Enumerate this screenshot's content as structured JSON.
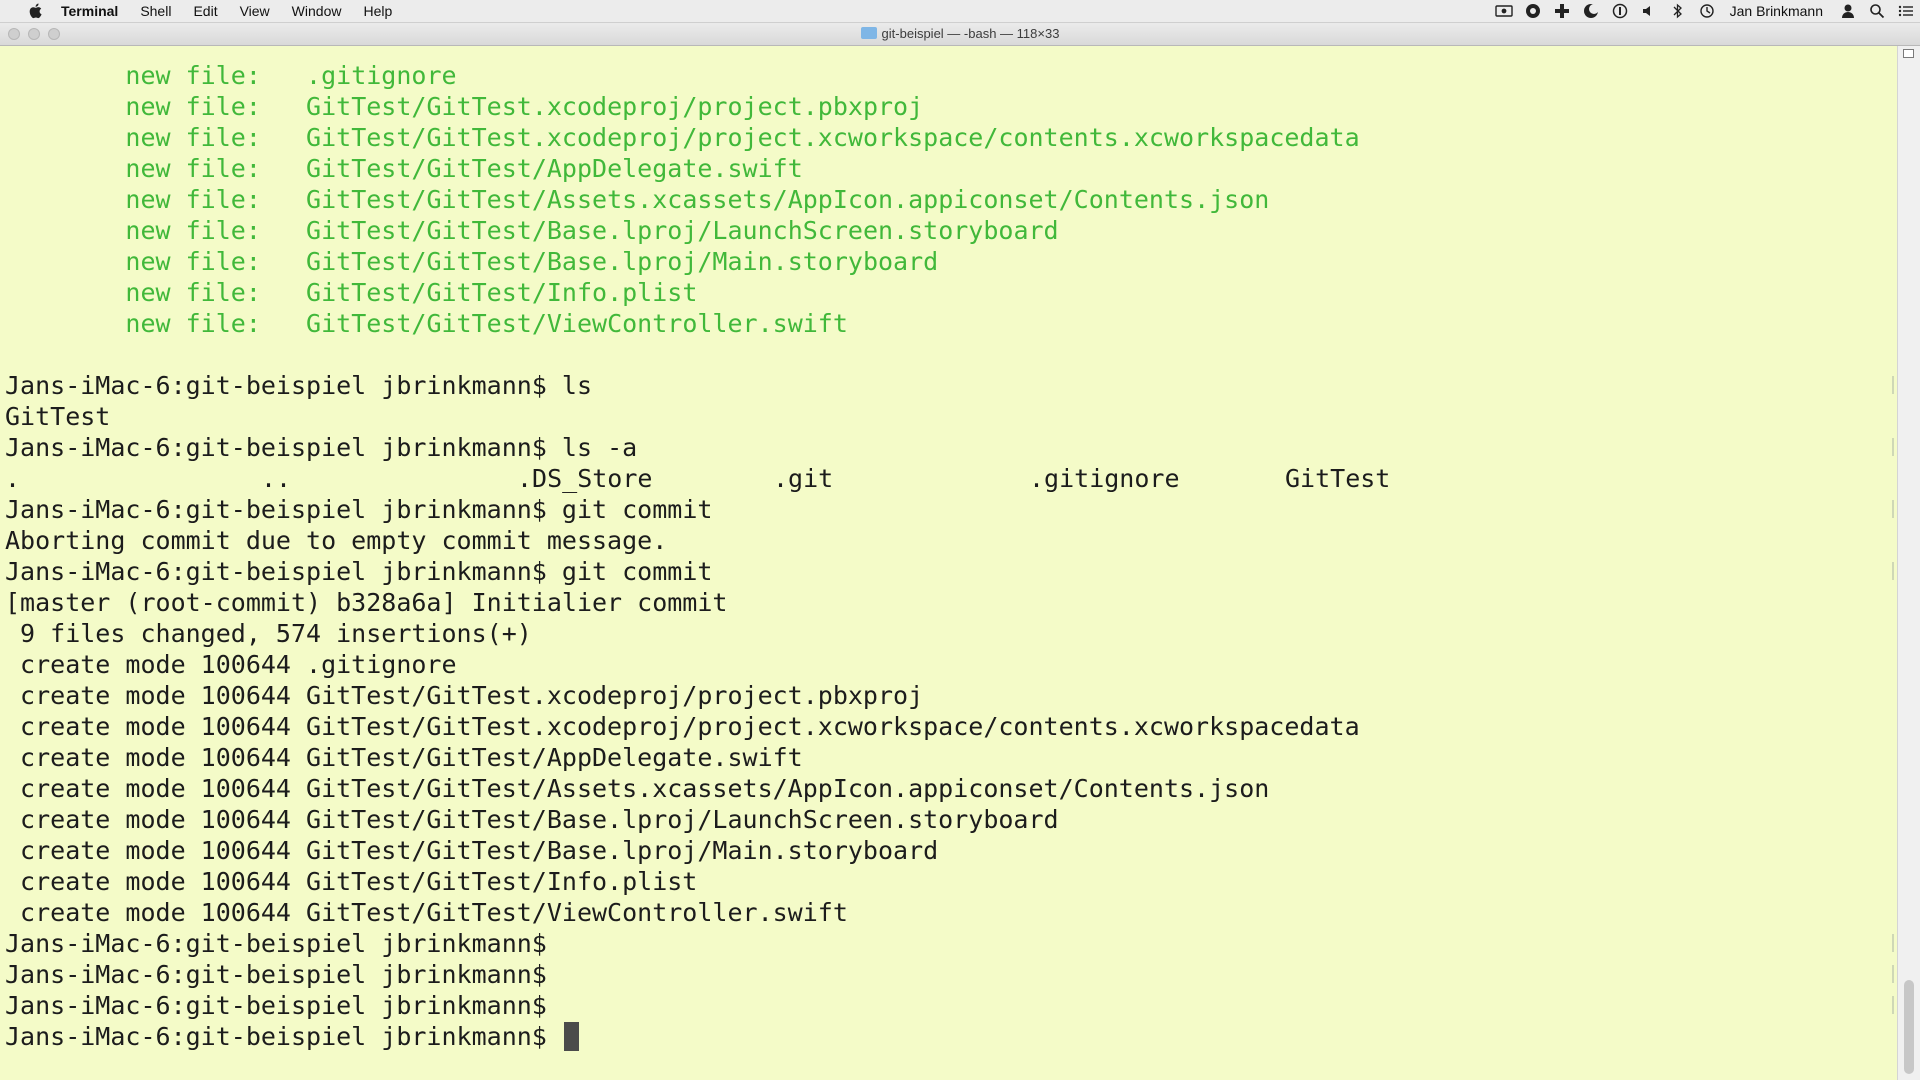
{
  "menubar": {
    "items": [
      "Terminal",
      "Shell",
      "Edit",
      "View",
      "Window",
      "Help"
    ],
    "user": "Jan Brinkmann",
    "status_icons": [
      "screen-record-icon",
      "creative-cloud-icon",
      "add-icon",
      "moon-icon",
      "info-icon",
      "volume-icon",
      "bluetooth-icon",
      "time-machine-icon"
    ]
  },
  "window": {
    "title": "git-beispiel — -bash — 118×33"
  },
  "terminal": {
    "colors": {
      "background": "#f4fbc8",
      "text": "#1c1c1c",
      "green": "#41b83a"
    },
    "staged_files": [
      {
        "label": "new file:",
        "path": ".gitignore"
      },
      {
        "label": "new file:",
        "path": "GitTest/GitTest.xcodeproj/project.pbxproj"
      },
      {
        "label": "new file:",
        "path": "GitTest/GitTest.xcodeproj/project.xcworkspace/contents.xcworkspacedata"
      },
      {
        "label": "new file:",
        "path": "GitTest/GitTest/AppDelegate.swift"
      },
      {
        "label": "new file:",
        "path": "GitTest/GitTest/Assets.xcassets/AppIcon.appiconset/Contents.json"
      },
      {
        "label": "new file:",
        "path": "GitTest/GitTest/Base.lproj/LaunchScreen.storyboard"
      },
      {
        "label": "new file:",
        "path": "GitTest/GitTest/Base.lproj/Main.storyboard"
      },
      {
        "label": "new file:",
        "path": "GitTest/GitTest/Info.plist"
      },
      {
        "label": "new file:",
        "path": "GitTest/GitTest/ViewController.swift"
      }
    ],
    "prompt": "Jans-iMac-6:git-beispiel jbrinkmann$",
    "cmd_ls": "ls",
    "out_ls": "GitTest",
    "cmd_ls_a": "ls -a",
    "out_ls_a": [
      ".",
      "..",
      ".DS_Store",
      ".git",
      ".gitignore",
      "GitTest"
    ],
    "cmd_commit": "git commit",
    "out_abort": "Aborting commit due to empty commit message.",
    "out_commit_header": "[master (root-commit) b328a6a] Initialier commit",
    "out_commit_stats": " 9 files changed, 574 insertions(+)",
    "out_create_modes": [
      " create mode 100644 .gitignore",
      " create mode 100644 GitTest/GitTest.xcodeproj/project.pbxproj",
      " create mode 100644 GitTest/GitTest.xcodeproj/project.xcworkspace/contents.xcworkspacedata",
      " create mode 100644 GitTest/GitTest/AppDelegate.swift",
      " create mode 100644 GitTest/GitTest/Assets.xcassets/AppIcon.appiconset/Contents.json",
      " create mode 100644 GitTest/GitTest/Base.lproj/LaunchScreen.storyboard",
      " create mode 100644 GitTest/GitTest/Base.lproj/Main.storyboard",
      " create mode 100644 GitTest/GitTest/Info.plist",
      " create mode 100644 GitTest/GitTest/ViewController.swift"
    ]
  }
}
